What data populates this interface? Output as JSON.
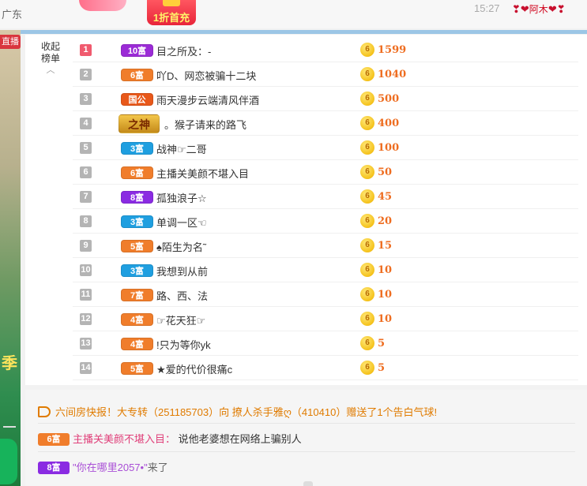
{
  "header": {
    "location": "广东",
    "promo_badge": "1折首充",
    "time": "15:27",
    "user_name": "阿木",
    "heart_icon": "heart-icon"
  },
  "sidebar": {
    "live_label": "直播",
    "banner_char": "季"
  },
  "panel": {
    "collapse_label_1": "收起",
    "collapse_label_2": "榜单",
    "collapse_icon": "chevron-up-icon"
  },
  "ranking": [
    {
      "rank": "1",
      "wealth": "10富",
      "wealth_color": "#9b2bd6",
      "name": "目之所及：-",
      "amount": "1599"
    },
    {
      "rank": "2",
      "wealth": "6富",
      "wealth_color": "#f07d2b",
      "name": "吖D、网恋被骗十二块",
      "amount": "1040"
    },
    {
      "rank": "3",
      "wealth": "国公",
      "wealth_color": "#e8581a",
      "name": "雨天漫步云端清风伴酒",
      "amount": "500"
    },
    {
      "rank": "4",
      "wealth": "之神",
      "wealth_color": "#d9a21b",
      "name": "。猴子请来的路飞",
      "amount": "400",
      "god": true
    },
    {
      "rank": "5",
      "wealth": "3富",
      "wealth_color": "#1f9fe0",
      "name": "战神☞二哥",
      "amount": "100"
    },
    {
      "rank": "6",
      "wealth": "6富",
      "wealth_color": "#f07d2b",
      "name": "主播关美颜不堪入目",
      "amount": "50"
    },
    {
      "rank": "7",
      "wealth": "8富",
      "wealth_color": "#8a2be2",
      "name": "孤独浪子☆",
      "amount": "45"
    },
    {
      "rank": "8",
      "wealth": "3富",
      "wealth_color": "#1f9fe0",
      "name": "单调一区☜",
      "amount": "20"
    },
    {
      "rank": "9",
      "wealth": "5富",
      "wealth_color": "#f07d2b",
      "name": "♠陌生为名˜",
      "amount": "15"
    },
    {
      "rank": "10",
      "wealth": "3富",
      "wealth_color": "#1f9fe0",
      "name": "我想到从前",
      "amount": "10"
    },
    {
      "rank": "11",
      "wealth": "7富",
      "wealth_color": "#f07d2b",
      "name": "路、西、法",
      "amount": "10"
    },
    {
      "rank": "12",
      "wealth": "4富",
      "wealth_color": "#f07d2b",
      "name": "☞花天狂☞",
      "amount": "10"
    },
    {
      "rank": "13",
      "wealth": "4富",
      "wealth_color": "#f07d2b",
      "name": "!只为等你yk",
      "amount": "5"
    },
    {
      "rank": "14",
      "wealth": "5富",
      "wealth_color": "#f07d2b",
      "name": "★爱的代价很痛c",
      "amount": "5"
    }
  ],
  "messages": {
    "broadcast": "六间房快报！大专转（251185703）向 撩人杀手雅ღ（410410）赠送了1个告白气球!",
    "chat_badge": "6富",
    "chat_badge_color": "#f07d2b",
    "chat_nick": "主播关美颜不堪入目：",
    "chat_text": "说他老婆想在网络上骗别人",
    "enter_badge": "8富",
    "enter_badge_color": "#8a2be2",
    "enter_nick": "\"你在哪里2057•\"",
    "enter_text": "来了"
  },
  "colors": {
    "amount": "#ee6d20",
    "rank_first": "#f05a6e",
    "broadcast": "#e07b00"
  }
}
